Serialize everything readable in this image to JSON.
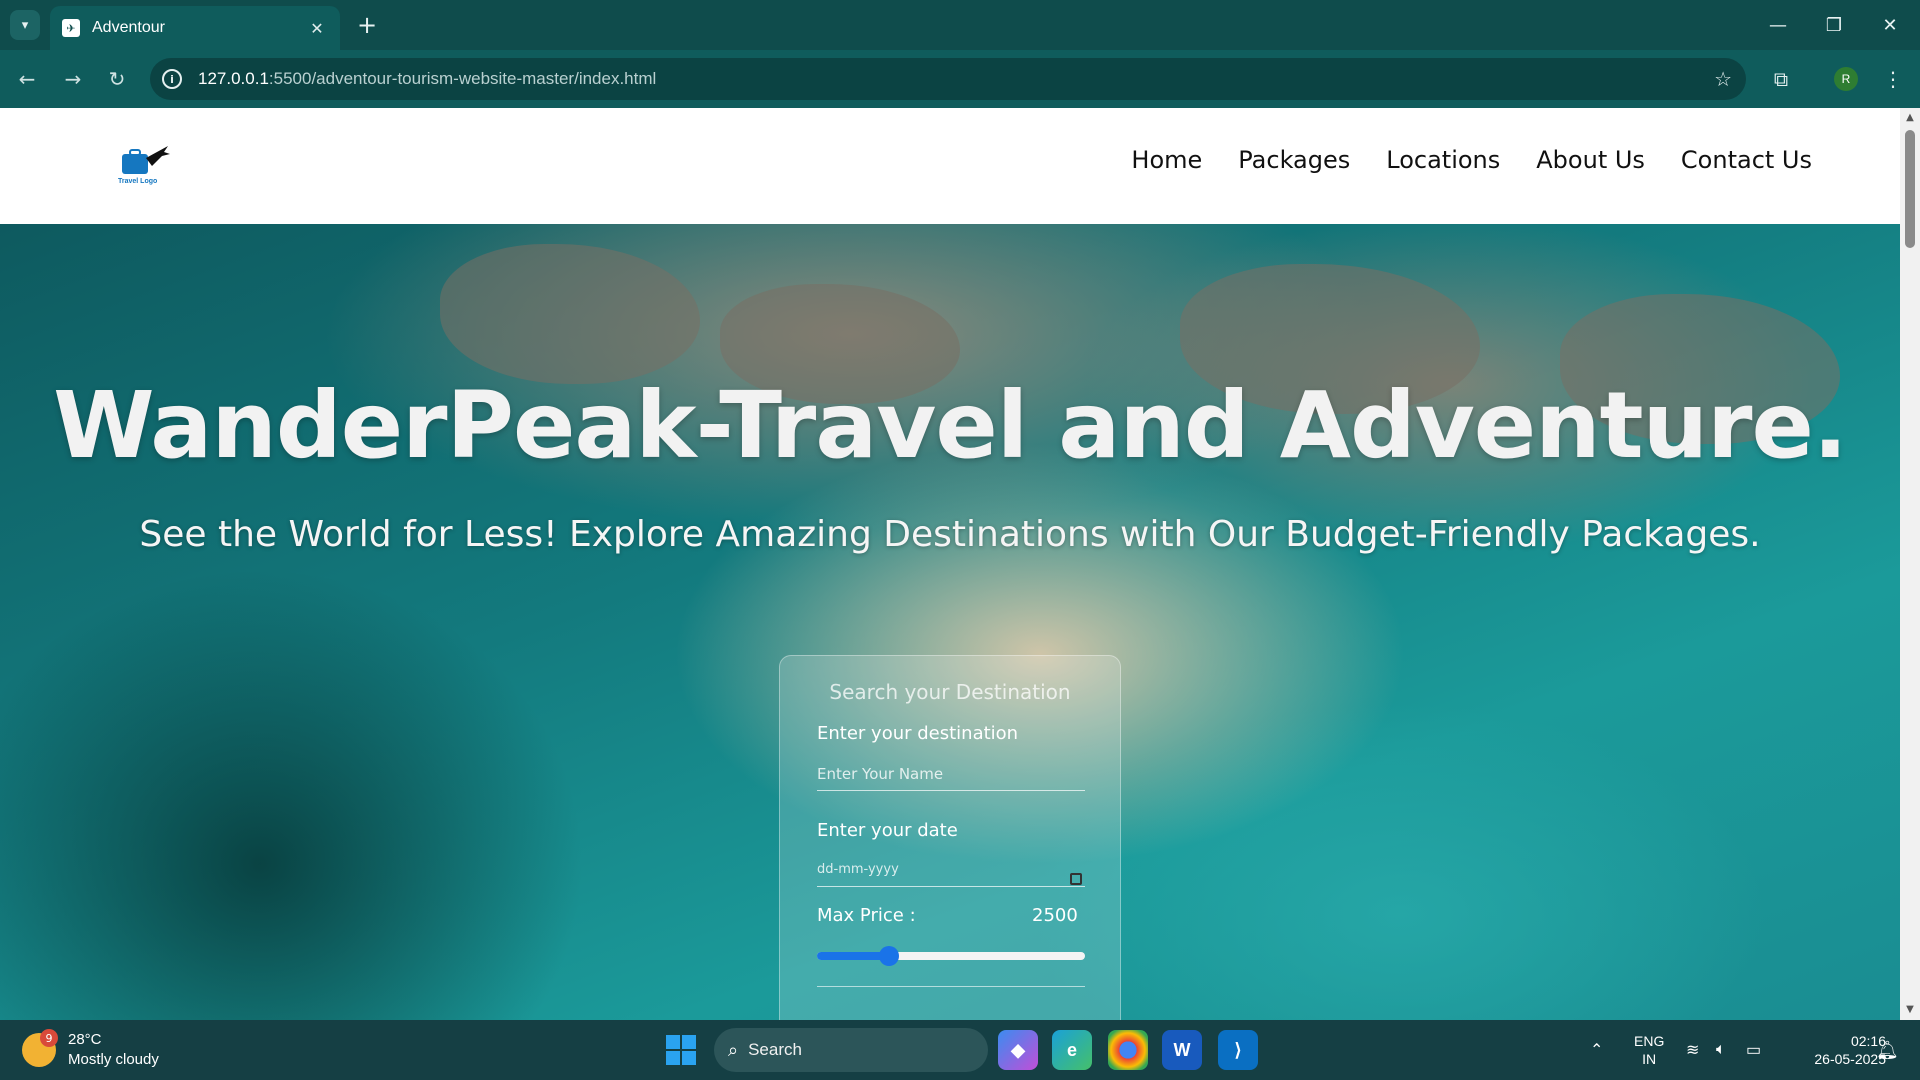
{
  "browser": {
    "tab_title": "Adventour",
    "url_host": "127.0.0.1",
    "url_rest": ":5500/adventour-tourism-website-master/index.html",
    "profile_initial": "R"
  },
  "site": {
    "logo_text": "Travel Logo",
    "nav": [
      "Home",
      "Packages",
      "Locations",
      "About Us",
      "Contact Us"
    ]
  },
  "hero": {
    "title": "WanderPeak-Travel and Adventure.",
    "subtitle": "See the World for Less! Explore Amazing Destinations with Our Budget-Friendly Packages."
  },
  "search_form": {
    "heading": "Search your Destination",
    "destination_label": "Enter your destination",
    "name_placeholder": "Enter Your Name",
    "date_label": "Enter your date",
    "date_placeholder": "dd-mm-yyyy",
    "price_label": "Max Price :",
    "price_value": "2500",
    "slider_fraction": 0.27
  },
  "taskbar": {
    "weather_temp": "28°C",
    "weather_desc": "Mostly cloudy",
    "weather_badge": "9",
    "search_label": "Search",
    "lang_line1": "ENG",
    "lang_line2": "IN",
    "time": "02:16",
    "date": "26-05-2025"
  },
  "colors": {
    "chrome_bg": "#0f4c4c",
    "accent_blue": "#1a73e8",
    "taskbar_bg": "#153f44"
  }
}
